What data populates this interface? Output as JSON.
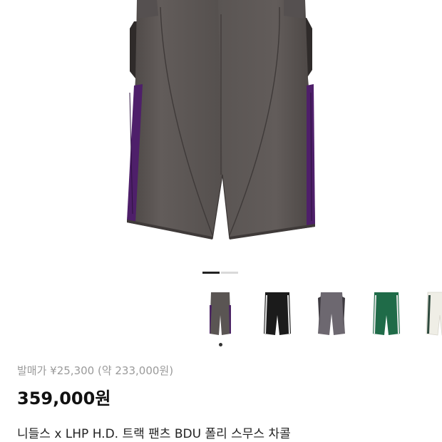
{
  "product": {
    "release_price": "발매가 ¥25,300 (약 233,000원)",
    "price": "359,000원",
    "title": "니들스 x LHP H.D. 트랙 팬츠 BDU 폴리 스무스 차콜"
  },
  "gallery": {
    "page_count": 2,
    "active_page": 1
  },
  "thumbnails": [
    {
      "name": "charcoal-purple",
      "body": "#5a5553",
      "stripe": "#4b2464"
    },
    {
      "name": "black-white",
      "body": "#1b1b1b",
      "stripe": "#e8e8e8"
    },
    {
      "name": "grey",
      "body": "#6d6870",
      "stripe": "#4a4550"
    },
    {
      "name": "green",
      "body": "#1f6b48",
      "stripe": "#e8e8e8"
    },
    {
      "name": "ivory",
      "body": "#efeee6",
      "stripe": "#2e4a3e"
    }
  ],
  "colors": {
    "pants_body": "#5d5856",
    "pants_shadow": "#4a4543",
    "stripe_purple": "#4e1f6a",
    "indicator_active": "#222222",
    "indicator_inactive": "#d9d9d9"
  }
}
